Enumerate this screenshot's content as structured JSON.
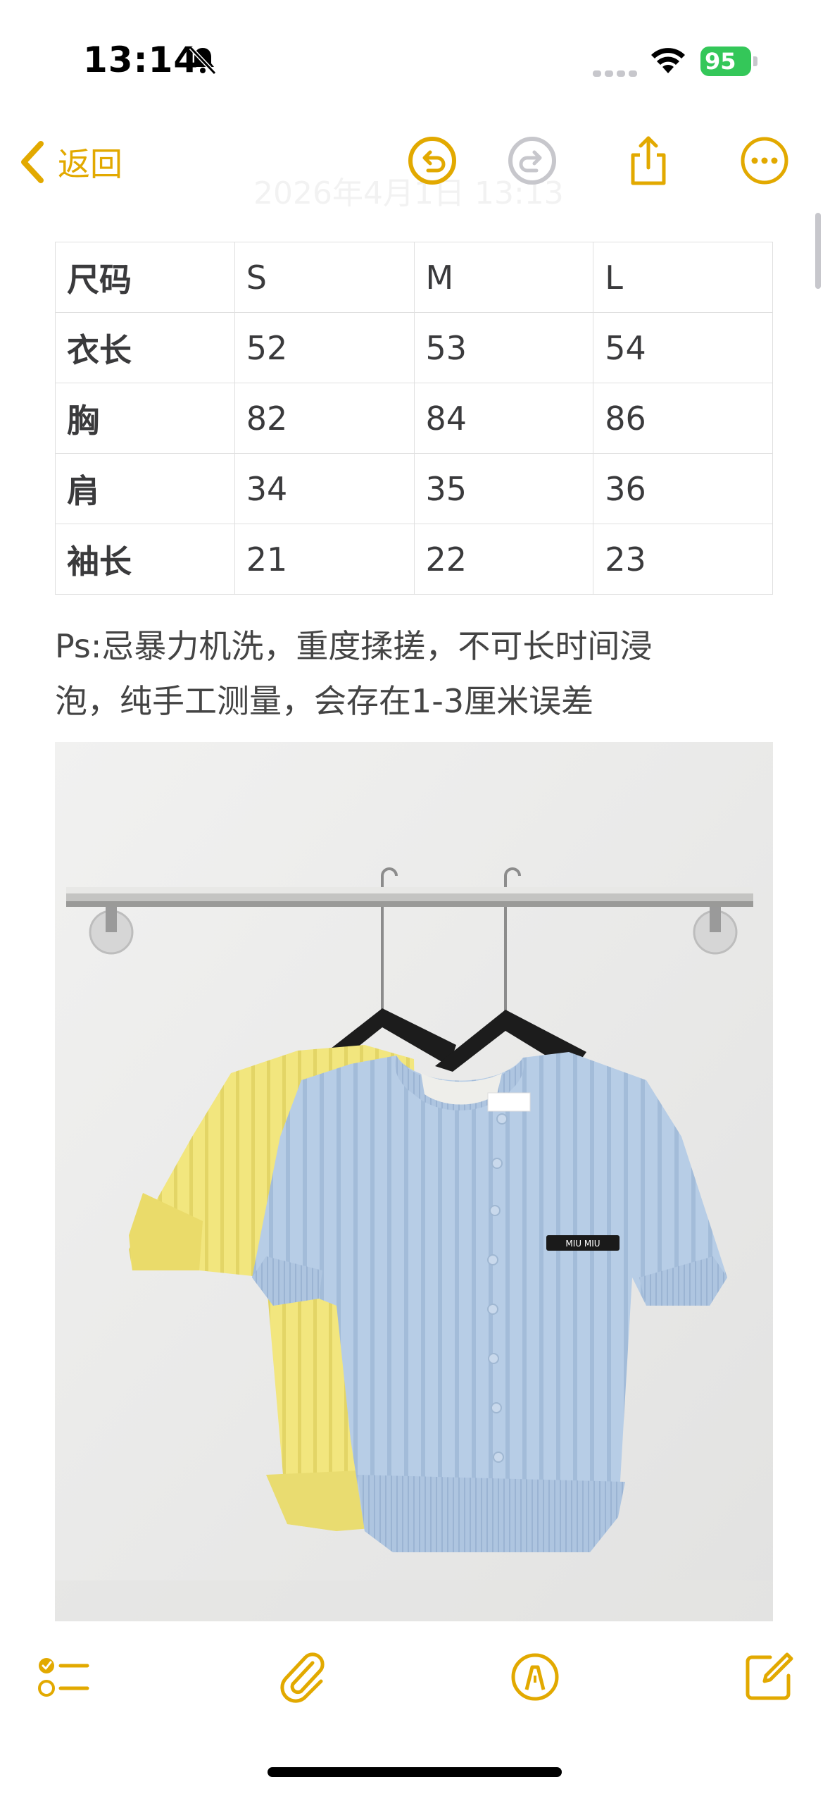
{
  "status_bar": {
    "time": "13:14",
    "battery": "95"
  },
  "nav": {
    "back_label": "返回",
    "faint_date": "2026年4月1日 13:13"
  },
  "table": {
    "rows": [
      [
        "尺码",
        "S",
        "M",
        "L"
      ],
      [
        "衣长",
        "52",
        "53",
        "54"
      ],
      [
        "胸",
        "82",
        "84",
        "86"
      ],
      [
        "肩",
        "34",
        "35",
        "36"
      ],
      [
        "袖长",
        "21",
        "22",
        "23"
      ]
    ]
  },
  "note": {
    "line1": "Ps:忌暴力机洗，重度揉搓，不可长时间浸",
    "line2": "泡，纯手工测量，会存在1-3厘米误差"
  },
  "photo": {
    "label_text": "MIU MIU"
  },
  "colors": {
    "accent": "#E2A900",
    "battery_green": "#34C759",
    "text": "#3A3A3C"
  }
}
